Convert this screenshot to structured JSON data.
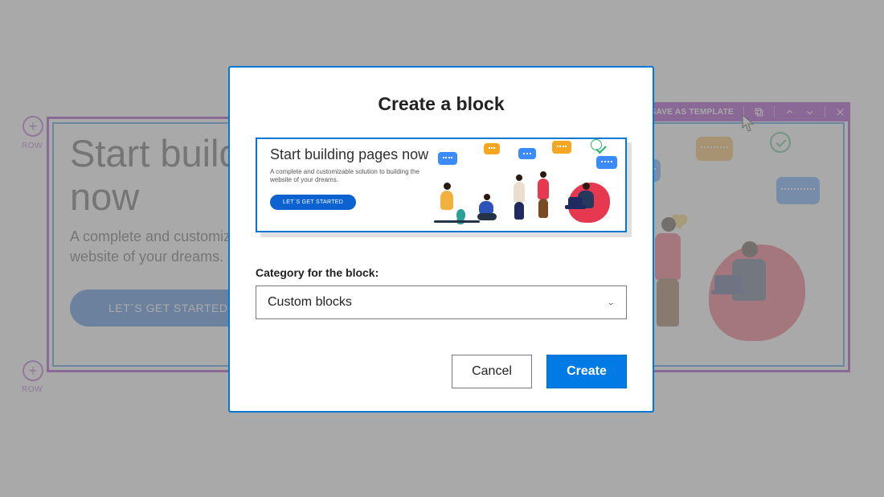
{
  "hero": {
    "title": "Start building pages now",
    "subtitle": "A complete and customizable solution to building the website of your dreams.",
    "cta": "LET`S GET STARTED"
  },
  "editor": {
    "row_label": "ROW",
    "save_template": "SAVE AS TEMPLATE"
  },
  "modal": {
    "title": "Create a block",
    "preview": {
      "title": "Start building pages now",
      "subtitle": "A complete and customizable solution to building the website of your dreams.",
      "cta": "LET`S GET STARTED"
    },
    "category_label": "Category for the block:",
    "category_value": "Custom blocks",
    "cancel": "Cancel",
    "create": "Create"
  },
  "colors": {
    "accent": "#0078D4",
    "editor": "#8500B4",
    "cta": "#0d62d1"
  }
}
